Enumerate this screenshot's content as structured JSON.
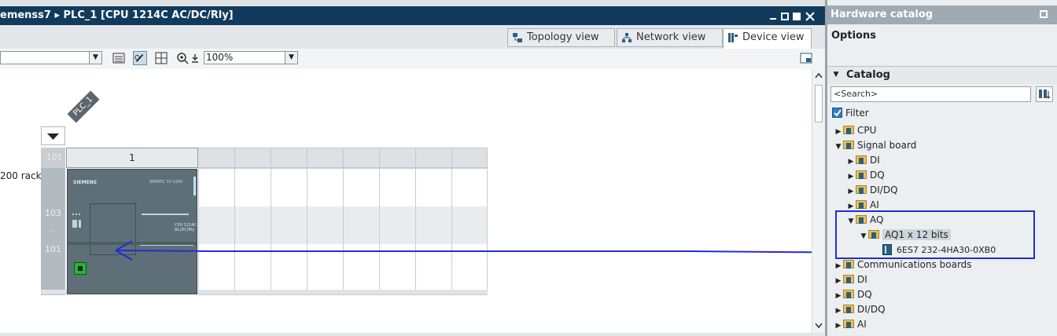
{
  "editor": {
    "title": "emenss7 ▸ PLC_1 [CPU 1214C AC/DC/Rly]",
    "tabs": [
      {
        "label": "Topology view",
        "icon": "topology-icon"
      },
      {
        "label": "Network view",
        "icon": "network-icon"
      },
      {
        "label": "Device view",
        "icon": "device-icon",
        "active": true
      }
    ],
    "toolbar": {
      "device_select": "",
      "zoom": "100%"
    },
    "device": {
      "name_tag": "PLC_1",
      "rack_label": "200 rack",
      "slot_header_left": ".101",
      "slot_header_1": "1",
      "slot_numbers": [
        "103",
        "-",
        "101"
      ],
      "cpu_brand": "SIEMENS",
      "cpu_series": "SIMATIC S7-1200",
      "cpu_model": "CPU 1214C AC/DC/Rly"
    }
  },
  "catalog": {
    "title": "Hardware catalog",
    "options_label": "Options",
    "catalog_label": "Catalog",
    "search_placeholder": "<Search>",
    "filter_label": "Filter",
    "filter_checked": true,
    "tree": [
      {
        "label": "CPU",
        "level": 0,
        "state": "collapsed"
      },
      {
        "label": "Signal board",
        "level": 0,
        "state": "expanded"
      },
      {
        "label": "DI",
        "level": 1,
        "state": "collapsed"
      },
      {
        "label": "DQ",
        "level": 1,
        "state": "collapsed"
      },
      {
        "label": "DI/DQ",
        "level": 1,
        "state": "collapsed"
      },
      {
        "label": "AI",
        "level": 1,
        "state": "collapsed"
      },
      {
        "label": "AQ",
        "level": 1,
        "state": "expanded"
      },
      {
        "label": "AQ1 x 12 bits",
        "level": 2,
        "state": "expanded",
        "selected": true
      },
      {
        "label": "6ES7 232-4HA30-0XB0",
        "level": 3,
        "state": "leaf"
      },
      {
        "label": "Communications boards",
        "level": 0,
        "state": "collapsed"
      },
      {
        "label": "DI",
        "level": 0,
        "state": "collapsed"
      },
      {
        "label": "DQ",
        "level": 0,
        "state": "collapsed"
      },
      {
        "label": "DI/DQ",
        "level": 0,
        "state": "collapsed"
      },
      {
        "label": "AI",
        "level": 0,
        "state": "collapsed"
      }
    ]
  },
  "colors": {
    "title_bar": "#113b5c",
    "annotation": "#1f2fd1",
    "cpu_body": "#5f6f78",
    "catalog_title": "#9faab3"
  }
}
